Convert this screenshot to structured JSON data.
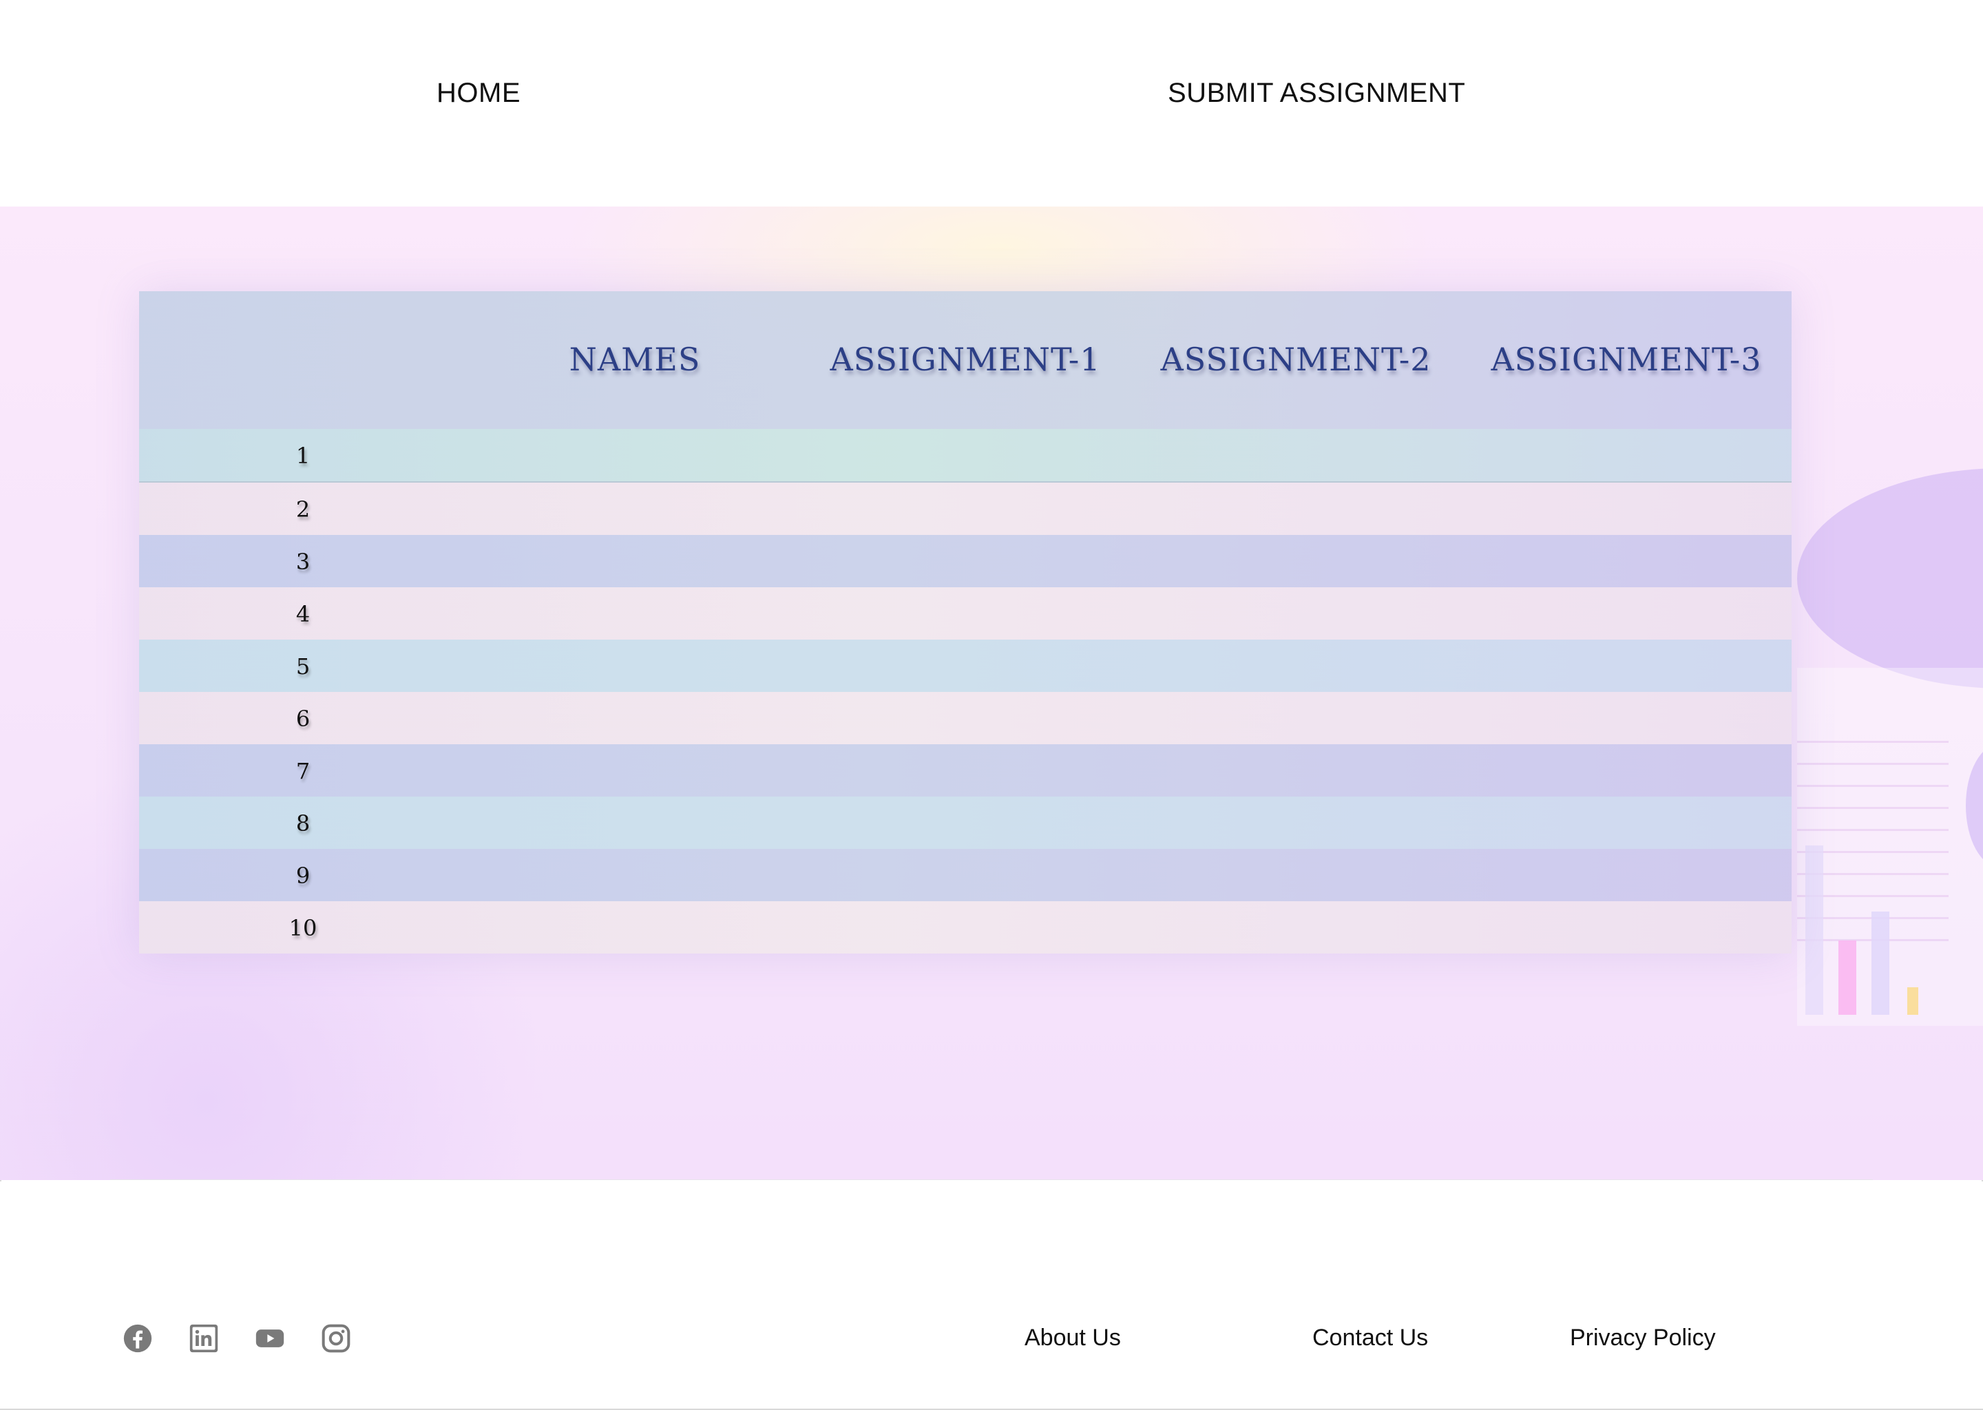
{
  "nav": {
    "home_label": "HOME",
    "submit_label": "SUBMIT ASSIGNMENT"
  },
  "table": {
    "columns": [
      "",
      "NAMES",
      "ASSIGNMENT-1",
      "ASSIGNMENT-2",
      "ASSIGNMENT-3"
    ],
    "rows": [
      "1",
      "2",
      "3",
      "4",
      "5",
      "6",
      "7",
      "8",
      "9",
      "10"
    ]
  },
  "footer": {
    "social_icons": [
      "facebook-icon",
      "linkedin-icon",
      "youtube-icon",
      "instagram-icon"
    ],
    "links": {
      "about": "About Us",
      "contact": "Contact Us",
      "privacy": "Privacy Policy"
    }
  },
  "colors": {
    "header_text": "#2c3f86",
    "icon_gray": "#7a7a7a",
    "background_tint": "#f6e4fb"
  }
}
